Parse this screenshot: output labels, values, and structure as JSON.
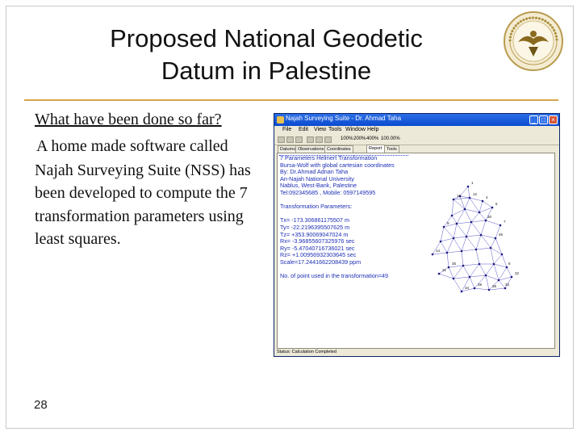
{
  "slide": {
    "title_line1": "Proposed National Geodetic",
    "title_line2": "Datum in Palestine",
    "subheading": "What have been done so far?",
    "bullet_marker": "",
    "bullet_text": "A home made software called Najah Surveying Suite (NSS) has been developed to compute the 7 transformation parameters using least squares.",
    "page_number": "28",
    "accent_color": "#d6a64b"
  },
  "app": {
    "window_title": "Najah Surveying Suite - Dr. Ahmad Taha",
    "menu": [
      "File",
      "Edit",
      "View",
      "Tools",
      "Window",
      "Help"
    ],
    "toolbar_zoom": [
      "100%",
      "200%",
      "400%",
      "100.00%"
    ],
    "tabs": [
      "Datums",
      "Observations",
      "Coordinates",
      "Report",
      "Tools"
    ],
    "report_lines": [
      "7 Parameters Helmert Transformation",
      "Bursa-Wolf with global cartesian coordinates",
      "By: Dr.Ahmad Adnan Taha",
      "An-Najah National University",
      "Nablus, West-Bank, Palestine",
      "Tel:092345685 , Mobile: 0597149595",
      "",
      "Transformation Parameters:",
      "",
      "Tx= -173.306861175507  m",
      "Ty= -22.2196395507625  m",
      "Tz= +353.90069047024  m",
      "Rx= -3.96855607325976 sec",
      "Ry= -5.47040716736021 sec",
      "Rz= +1.00956932303645 sec",
      "Scale=17.2441662208439 ppm",
      "",
      "No. of point used in the transformation=49"
    ],
    "status_text": "Status: Calculation Completed",
    "network_labels": [
      "1",
      "4",
      "5",
      "7",
      "8",
      "32",
      "33",
      "38",
      "39",
      "34",
      "35",
      "31",
      "14",
      "9",
      "13",
      "12",
      "30",
      "46"
    ]
  }
}
